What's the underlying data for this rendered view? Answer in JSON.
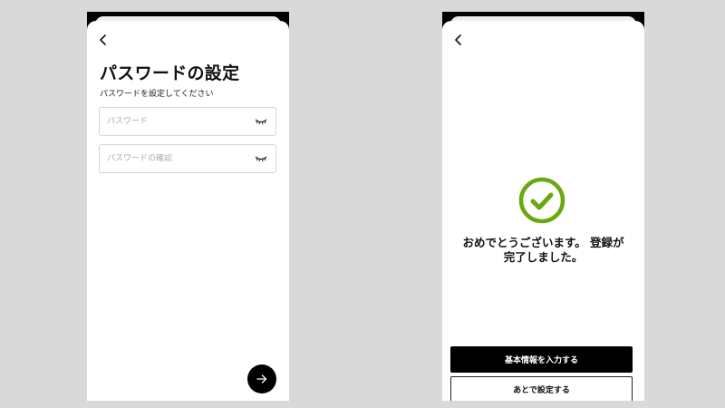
{
  "colors": {
    "page_background": "#d9d9d9",
    "primary": "#000000",
    "success_check": "#6aa80f",
    "input_border": "#d6d6d6",
    "placeholder": "#a9a9a9"
  },
  "password_screen": {
    "back_icon": "chevron-left-icon",
    "title": "パスワードの設定",
    "subtitle": "パスワードを設定してください",
    "password_field": {
      "value": "",
      "placeholder": "パスワード",
      "toggle_icon": "eye-closed-icon"
    },
    "confirm_field": {
      "value": "",
      "placeholder": "パスワードの確認",
      "toggle_icon": "eye-closed-icon"
    },
    "next_icon": "arrow-right-icon"
  },
  "complete_screen": {
    "back_icon": "chevron-left-icon",
    "status_icon": "check-circle-icon",
    "message_line1": "おめでとうございます。 登録が",
    "message_line2": "完了しました。",
    "primary_button_label": "基本情報を入力する",
    "secondary_button_label": "あとで設定する"
  }
}
